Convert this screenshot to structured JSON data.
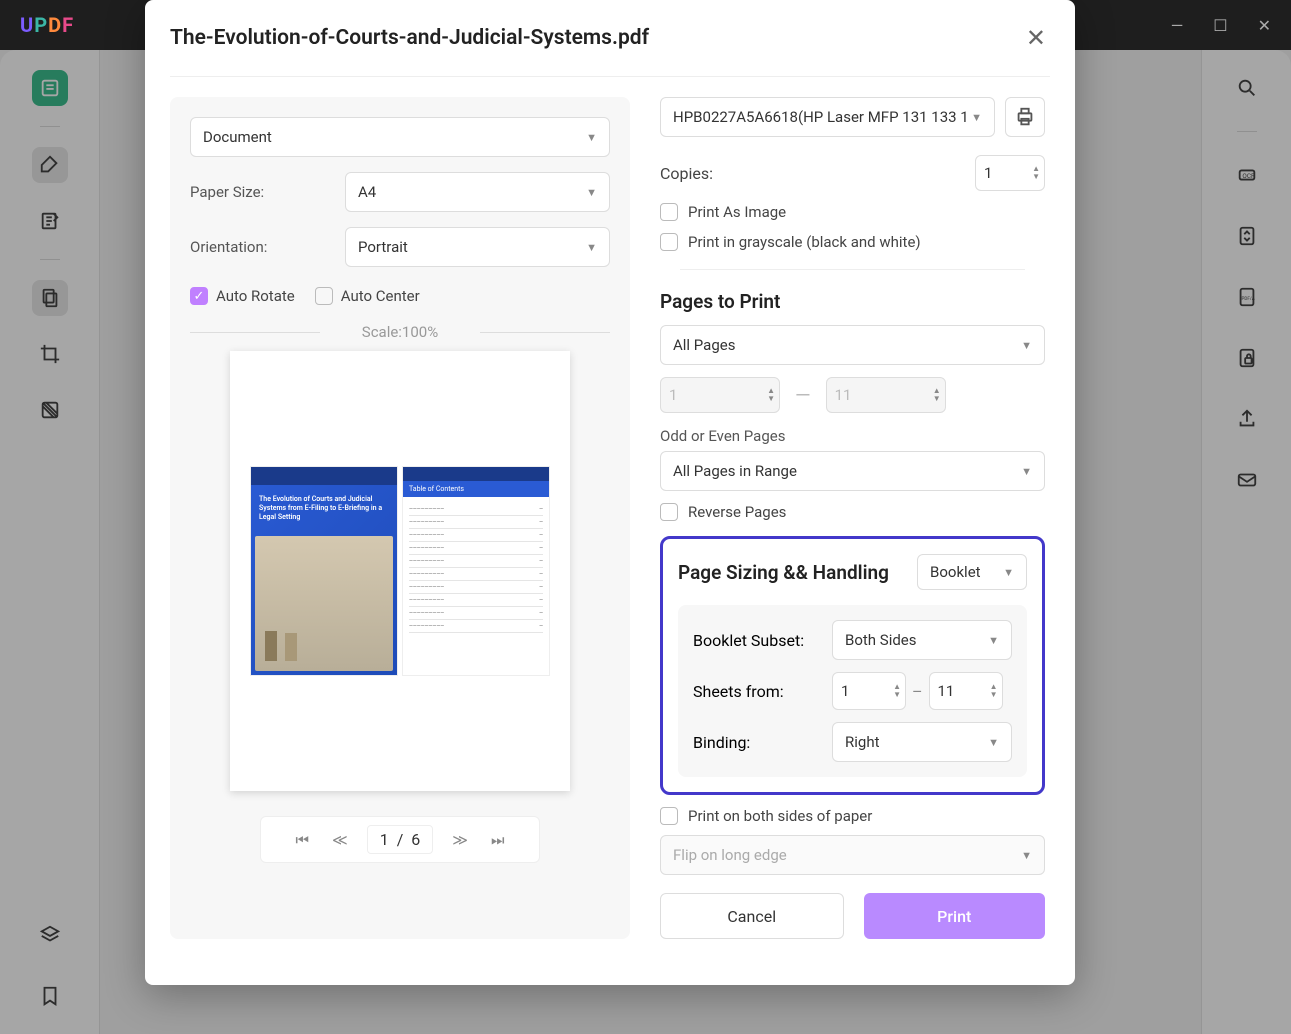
{
  "app": {
    "logo_chars": [
      "U",
      "P",
      "D",
      "F"
    ]
  },
  "window": {
    "minimize": "—",
    "maximize": "☐",
    "close": "✕"
  },
  "dialog": {
    "title": "The-Evolution-of-Courts-and-Judicial-Systems.pdf",
    "left": {
      "type_select": "Document",
      "paper_size_label": "Paper Size:",
      "paper_size": "A4",
      "orientation_label": "Orientation:",
      "orientation": "Portrait",
      "auto_rotate": "Auto Rotate",
      "auto_center": "Auto Center",
      "scale": "Scale:100%",
      "preview_title": "The Evolution of Courts and Judicial Systems from E-Filing to E-Briefing in a Legal Setting",
      "preview_toc": "Table of Contents",
      "pager": {
        "current": "1",
        "sep": "/",
        "total": "6"
      }
    },
    "right": {
      "printer": "HPB0227A5A6618(HP Laser MFP 131 133 1",
      "copies_label": "Copies:",
      "copies": "1",
      "print_image": "Print As Image",
      "grayscale": "Print in grayscale (black and white)",
      "pages_title": "Pages to Print",
      "pages_select": "All Pages",
      "range_from": "1",
      "range_to": "11",
      "odd_even_label": "Odd or Even Pages",
      "odd_even": "All Pages in Range",
      "reverse": "Reverse Pages",
      "ps_title": "Page Sizing && Handling",
      "ps_select": "Booklet",
      "subset_label": "Booklet Subset:",
      "subset": "Both Sides",
      "sheets_label": "Sheets from:",
      "sheets_from": "1",
      "sheets_to": "11",
      "binding_label": "Binding:",
      "binding": "Right",
      "both_sides": "Print on both sides of paper",
      "flip": "Flip on long edge",
      "cancel": "Cancel",
      "print": "Print"
    }
  }
}
